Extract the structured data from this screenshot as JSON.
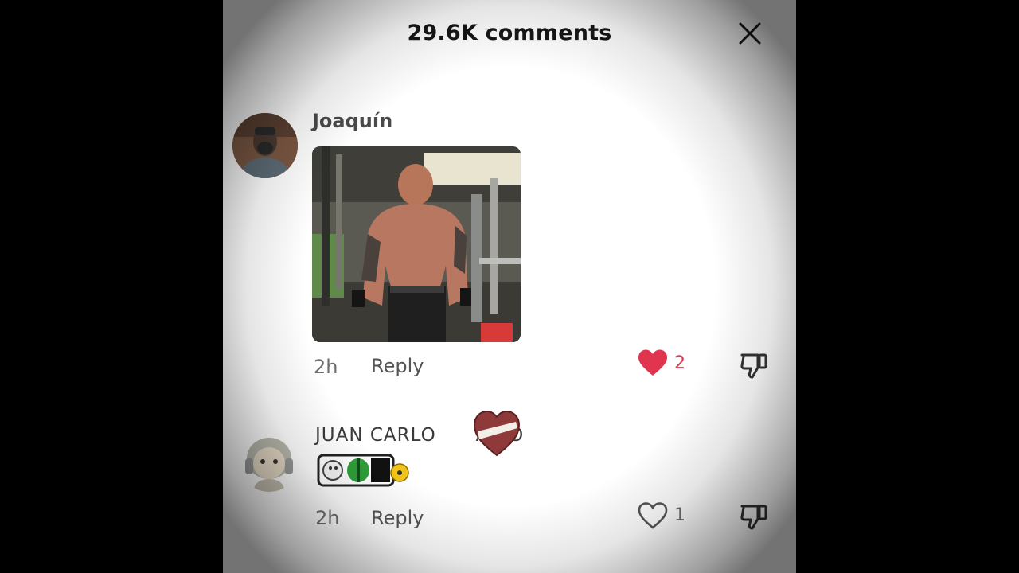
{
  "header": {
    "title": "29.6K comments",
    "close_icon": "close-icon"
  },
  "comments": [
    {
      "username": "Joaquín",
      "has_image": true,
      "time": "2h",
      "reply_label": "Reply",
      "likes": "2",
      "liked": true,
      "like_color": "#e0344f"
    },
    {
      "username": "JUAN CARLO      ARIO",
      "time": "2h",
      "reply_label": "Reply",
      "likes": "1",
      "liked": false
    }
  ],
  "colors": {
    "background": "#ffffff",
    "text": "#161616",
    "muted": "#6f6f6f",
    "like_red": "#e0344f"
  }
}
